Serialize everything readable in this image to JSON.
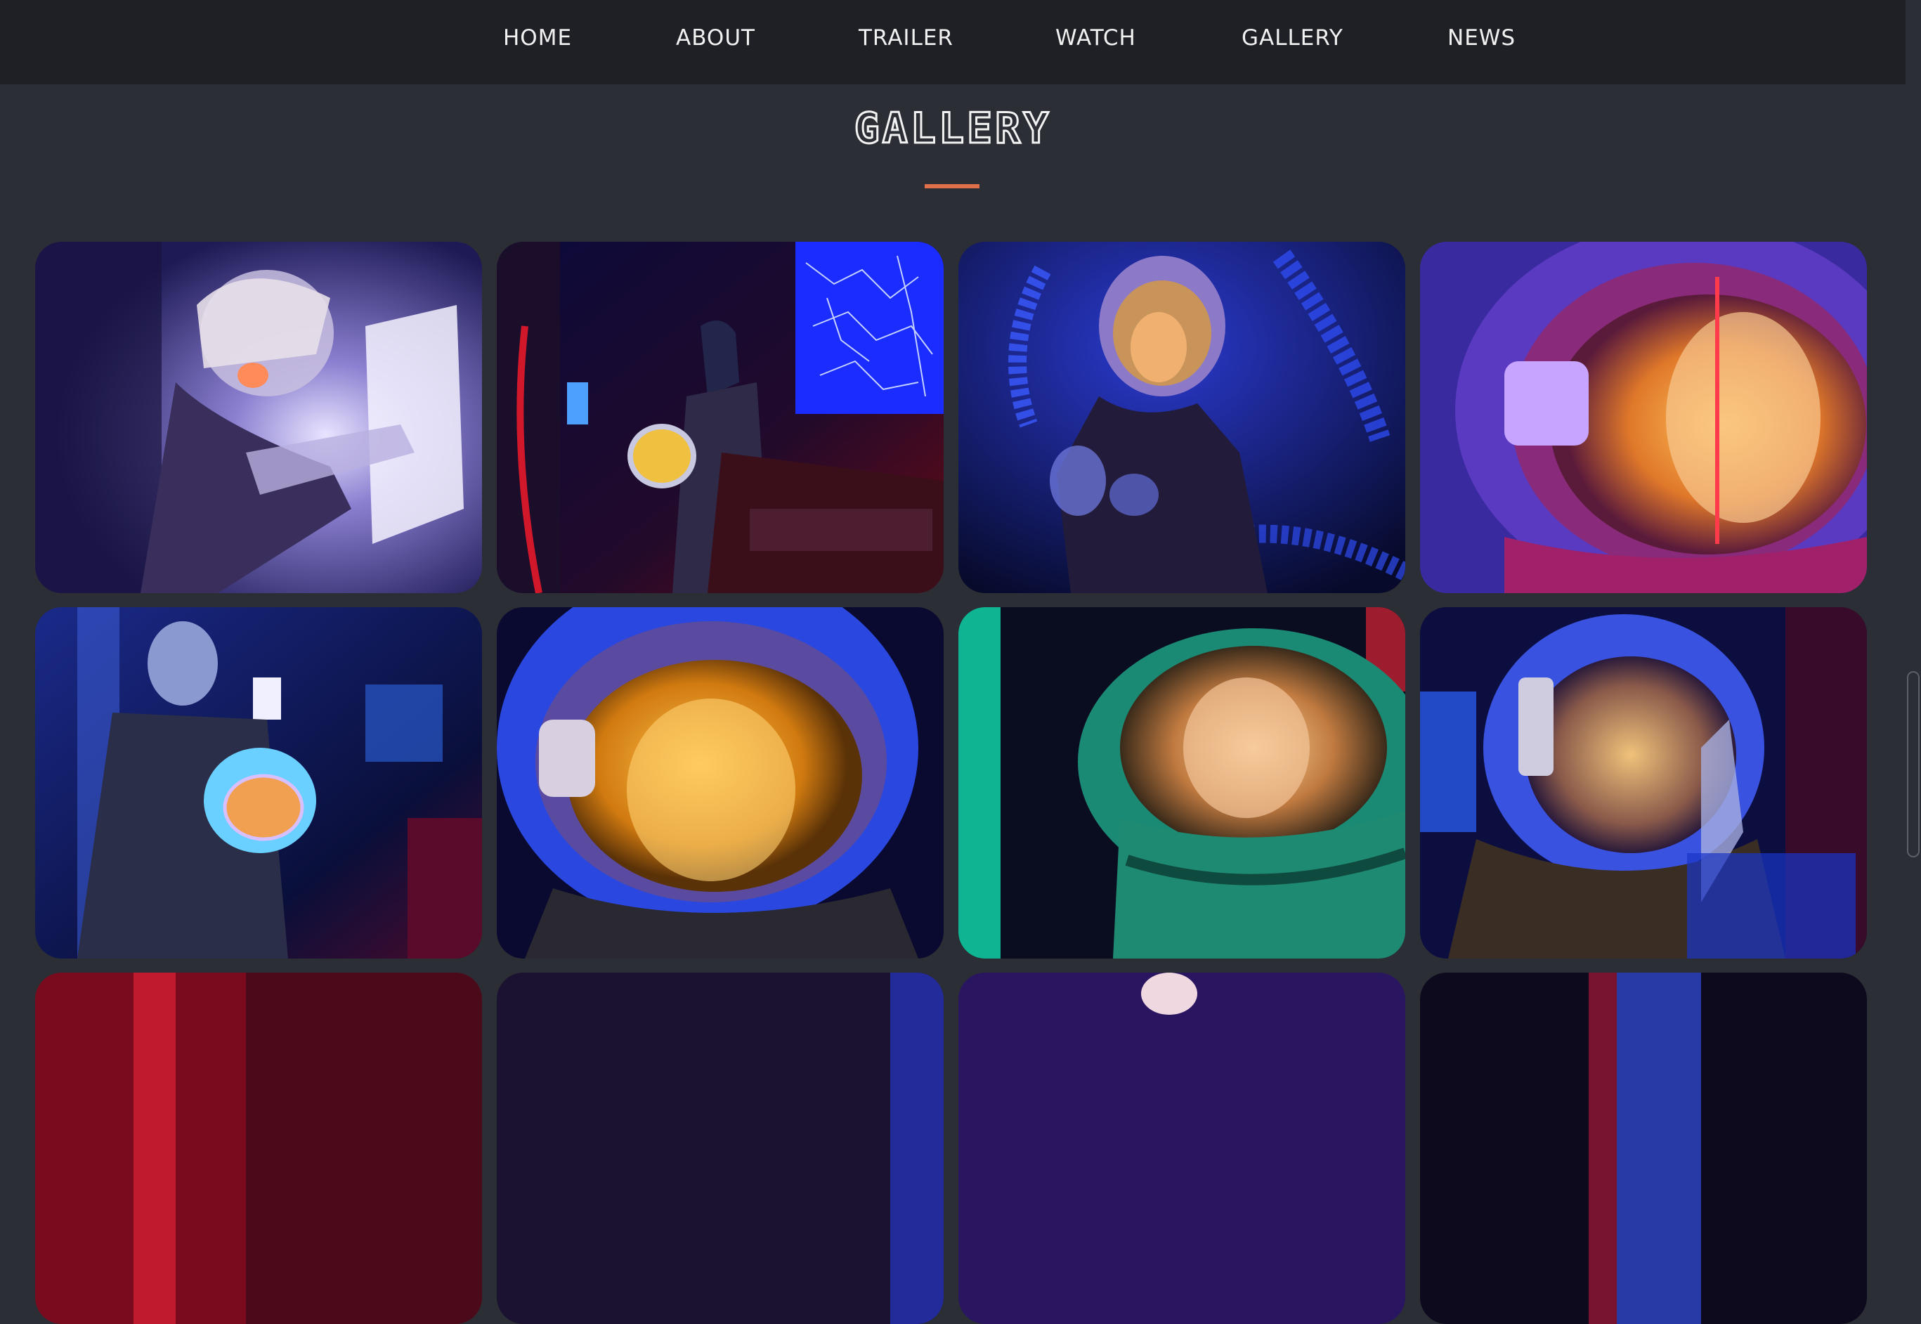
{
  "nav": {
    "items": [
      {
        "label": "HOME"
      },
      {
        "label": "ABOUT"
      },
      {
        "label": "TRAILER"
      },
      {
        "label": "WATCH"
      },
      {
        "label": "GALLERY"
      },
      {
        "label": "NEWS"
      }
    ]
  },
  "gallery": {
    "title": "GALLERY",
    "accent_color": "#e0704a",
    "photos": [
      {
        "subject": "astronaut-at-window"
      },
      {
        "subject": "astronaut-star-map-console"
      },
      {
        "subject": "astronaut-adjusting-helmet"
      },
      {
        "subject": "astronaut-helmet-closeup-orange"
      },
      {
        "subject": "astronaut-seated-holding-helmet"
      },
      {
        "subject": "astronaut-helmet-closeup-yellow"
      },
      {
        "subject": "astronaut-green-helmet"
      },
      {
        "subject": "astronaut-helmet-hand-raised"
      },
      {
        "subject": "partial-row-photo-1"
      },
      {
        "subject": "partial-row-photo-2"
      },
      {
        "subject": "partial-row-photo-3"
      },
      {
        "subject": "partial-row-photo-4"
      }
    ]
  },
  "colors": {
    "page_bg": "#2b2e35",
    "nav_bg": "#1f2025",
    "nav_text": "#f1f1f1"
  }
}
